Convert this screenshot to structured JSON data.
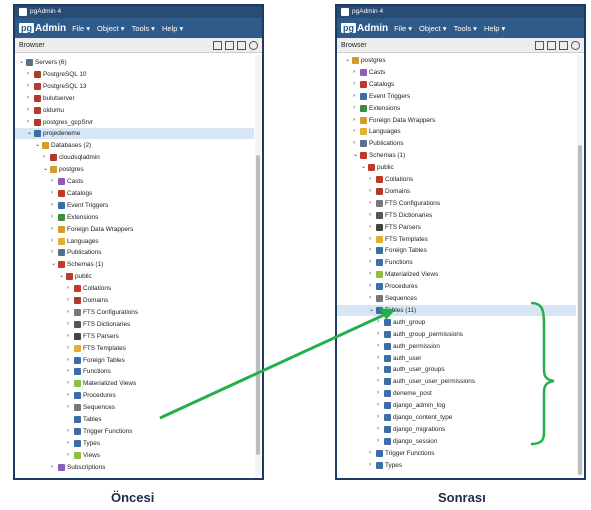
{
  "window_title": "pgAdmin 4",
  "logo": {
    "pg": "pg",
    "rest": "Admin"
  },
  "menus": [
    "File ▾",
    "Object ▾",
    "Tools ▾",
    "Help ▾"
  ],
  "browser_label": "Browser",
  "captions": {
    "left": "Öncesi",
    "right": "Sonrası"
  },
  "colors": {
    "header": "#2f5b8a",
    "arrow": "#22b04b",
    "selected": "#d6e6f5"
  },
  "left_tree": [
    {
      "label": "Servers (6)",
      "depth": 0,
      "toggle": "v",
      "icon": "servers-icon",
      "color": "#5a6f8c"
    },
    {
      "label": "PostgreSQL 10",
      "depth": 1,
      "toggle": ">",
      "icon": "server-icon",
      "color": "#b03a2e"
    },
    {
      "label": "PostgreSQL 13",
      "depth": 1,
      "toggle": ">",
      "icon": "server-icon",
      "color": "#b03a2e"
    },
    {
      "label": "bulutserver",
      "depth": 1,
      "toggle": ">",
      "icon": "server-icon",
      "color": "#b03a2e"
    },
    {
      "label": "oldumu",
      "depth": 1,
      "toggle": ">",
      "icon": "server-icon",
      "color": "#b03a2e"
    },
    {
      "label": "postgres_gcpSrvr",
      "depth": 1,
      "toggle": ">",
      "icon": "server-icon",
      "color": "#b03a2e"
    },
    {
      "label": "projedeneme",
      "depth": 1,
      "toggle": "v",
      "icon": "server-connected-icon",
      "color": "#3a6ea5",
      "selected": true
    },
    {
      "label": "Databases (2)",
      "depth": 2,
      "toggle": "v",
      "icon": "databases-icon",
      "color": "#d39b2a"
    },
    {
      "label": "cloudsqladmin",
      "depth": 3,
      "toggle": ">",
      "icon": "database-icon",
      "color": "#b03a2e"
    },
    {
      "label": "postgres",
      "depth": 3,
      "toggle": "v",
      "icon": "database-icon",
      "color": "#d39b2a"
    },
    {
      "label": "Casts",
      "depth": 4,
      "toggle": ">",
      "icon": "casts-icon",
      "color": "#8e5bb5"
    },
    {
      "label": "Catalogs",
      "depth": 4,
      "toggle": ">",
      "icon": "catalogs-icon",
      "color": "#c0392b"
    },
    {
      "label": "Event Triggers",
      "depth": 4,
      "toggle": ">",
      "icon": "event-triggers-icon",
      "color": "#3a6ea5"
    },
    {
      "label": "Extensions",
      "depth": 4,
      "toggle": ">",
      "icon": "extensions-icon",
      "color": "#3c8d3c"
    },
    {
      "label": "Foreign Data Wrappers",
      "depth": 4,
      "toggle": ">",
      "icon": "fdw-icon",
      "color": "#d39b2a"
    },
    {
      "label": "Languages",
      "depth": 4,
      "toggle": ">",
      "icon": "languages-icon",
      "color": "#e0b22c"
    },
    {
      "label": "Publications",
      "depth": 4,
      "toggle": ">",
      "icon": "publications-icon",
      "color": "#5a6f8c"
    },
    {
      "label": "Schemas (1)",
      "depth": 4,
      "toggle": "v",
      "icon": "schemas-icon",
      "color": "#c0392b"
    },
    {
      "label": "public",
      "depth": 5,
      "toggle": "v",
      "icon": "schema-icon",
      "color": "#c0392b"
    },
    {
      "label": "Collations",
      "depth": 6,
      "toggle": ">",
      "icon": "collations-icon",
      "color": "#c0392b"
    },
    {
      "label": "Domains",
      "depth": 6,
      "toggle": ">",
      "icon": "domains-icon",
      "color": "#b03a2e"
    },
    {
      "label": "FTS Configurations",
      "depth": 6,
      "toggle": ">",
      "icon": "fts-config-icon",
      "color": "#777777"
    },
    {
      "label": "FTS Dictionaries",
      "depth": 6,
      "toggle": ">",
      "icon": "fts-dict-icon",
      "color": "#555555"
    },
    {
      "label": "FTS Parsers",
      "depth": 6,
      "toggle": ">",
      "icon": "fts-parsers-icon",
      "color": "#444444"
    },
    {
      "label": "FTS Templates",
      "depth": 6,
      "toggle": ">",
      "icon": "fts-templates-icon",
      "color": "#e0b22c"
    },
    {
      "label": "Foreign Tables",
      "depth": 6,
      "toggle": ">",
      "icon": "foreign-tables-icon",
      "color": "#3a6ea5"
    },
    {
      "label": "Functions",
      "depth": 6,
      "toggle": ">",
      "icon": "functions-icon",
      "color": "#3a6ea5"
    },
    {
      "label": "Materialized Views",
      "depth": 6,
      "toggle": ">",
      "icon": "mviews-icon",
      "color": "#8cbf3f"
    },
    {
      "label": "Procedures",
      "depth": 6,
      "toggle": ">",
      "icon": "procedures-icon",
      "color": "#3a6ea5"
    },
    {
      "label": "Sequences",
      "depth": 6,
      "toggle": ">",
      "icon": "sequences-icon",
      "color": "#777777"
    },
    {
      "label": "Tables",
      "depth": 6,
      "toggle": "",
      "icon": "tables-icon",
      "color": "#3a6ea5"
    },
    {
      "label": "Trigger Functions",
      "depth": 6,
      "toggle": ">",
      "icon": "trigger-functions-icon",
      "color": "#3a6ea5"
    },
    {
      "label": "Types",
      "depth": 6,
      "toggle": ">",
      "icon": "types-icon",
      "color": "#3a6ea5"
    },
    {
      "label": "Views",
      "depth": 6,
      "toggle": ">",
      "icon": "views-icon",
      "color": "#8cbf3f"
    },
    {
      "label": "Subscriptions",
      "depth": 4,
      "toggle": ">",
      "icon": "subscriptions-icon",
      "color": "#8e5bb5"
    }
  ],
  "right_tree": [
    {
      "label": "postgres",
      "depth": 3,
      "toggle": "v",
      "icon": "database-icon",
      "color": "#d39b2a"
    },
    {
      "label": "Casts",
      "depth": 4,
      "toggle": ">",
      "icon": "casts-icon",
      "color": "#8e5bb5"
    },
    {
      "label": "Catalogs",
      "depth": 4,
      "toggle": ">",
      "icon": "catalogs-icon",
      "color": "#c0392b"
    },
    {
      "label": "Event Triggers",
      "depth": 4,
      "toggle": ">",
      "icon": "event-triggers-icon",
      "color": "#3a6ea5"
    },
    {
      "label": "Extensions",
      "depth": 4,
      "toggle": ">",
      "icon": "extensions-icon",
      "color": "#3c8d3c"
    },
    {
      "label": "Foreign Data Wrappers",
      "depth": 4,
      "toggle": ">",
      "icon": "fdw-icon",
      "color": "#d39b2a"
    },
    {
      "label": "Languages",
      "depth": 4,
      "toggle": ">",
      "icon": "languages-icon",
      "color": "#e0b22c"
    },
    {
      "label": "Publications",
      "depth": 4,
      "toggle": ">",
      "icon": "publications-icon",
      "color": "#5a6f8c"
    },
    {
      "label": "Schemas (1)",
      "depth": 4,
      "toggle": "v",
      "icon": "schemas-icon",
      "color": "#c0392b"
    },
    {
      "label": "public",
      "depth": 5,
      "toggle": "v",
      "icon": "schema-icon",
      "color": "#c0392b"
    },
    {
      "label": "Collations",
      "depth": 6,
      "toggle": ">",
      "icon": "collations-icon",
      "color": "#c0392b"
    },
    {
      "label": "Domains",
      "depth": 6,
      "toggle": ">",
      "icon": "domains-icon",
      "color": "#b03a2e"
    },
    {
      "label": "FTS Configurations",
      "depth": 6,
      "toggle": ">",
      "icon": "fts-config-icon",
      "color": "#777777"
    },
    {
      "label": "FTS Dictionaries",
      "depth": 6,
      "toggle": ">",
      "icon": "fts-dict-icon",
      "color": "#555555"
    },
    {
      "label": "FTS Parsers",
      "depth": 6,
      "toggle": ">",
      "icon": "fts-parsers-icon",
      "color": "#444444"
    },
    {
      "label": "FTS Templates",
      "depth": 6,
      "toggle": ">",
      "icon": "fts-templates-icon",
      "color": "#e0b22c"
    },
    {
      "label": "Foreign Tables",
      "depth": 6,
      "toggle": ">",
      "icon": "foreign-tables-icon",
      "color": "#3a6ea5"
    },
    {
      "label": "Functions",
      "depth": 6,
      "toggle": ">",
      "icon": "functions-icon",
      "color": "#3a6ea5"
    },
    {
      "label": "Materialized Views",
      "depth": 6,
      "toggle": ">",
      "icon": "mviews-icon",
      "color": "#8cbf3f"
    },
    {
      "label": "Procedures",
      "depth": 6,
      "toggle": ">",
      "icon": "procedures-icon",
      "color": "#3a6ea5"
    },
    {
      "label": "Sequences",
      "depth": 6,
      "toggle": ">",
      "icon": "sequences-icon",
      "color": "#777777"
    },
    {
      "label": "Tables (11)",
      "depth": 6,
      "toggle": "v",
      "icon": "tables-icon",
      "color": "#3a6ea5",
      "selected": true
    },
    {
      "label": "auth_group",
      "depth": 7,
      "toggle": ">",
      "icon": "table-icon",
      "color": "#3a6ea5"
    },
    {
      "label": "auth_group_permissions",
      "depth": 7,
      "toggle": ">",
      "icon": "table-icon",
      "color": "#3a6ea5"
    },
    {
      "label": "auth_permission",
      "depth": 7,
      "toggle": ">",
      "icon": "table-icon",
      "color": "#3a6ea5"
    },
    {
      "label": "auth_user",
      "depth": 7,
      "toggle": ">",
      "icon": "table-icon",
      "color": "#3a6ea5"
    },
    {
      "label": "auth_user_groups",
      "depth": 7,
      "toggle": ">",
      "icon": "table-icon",
      "color": "#3a6ea5"
    },
    {
      "label": "auth_user_user_permissions",
      "depth": 7,
      "toggle": ">",
      "icon": "table-icon",
      "color": "#3a6ea5"
    },
    {
      "label": "deneme_post",
      "depth": 7,
      "toggle": ">",
      "icon": "table-icon",
      "color": "#3a6ea5"
    },
    {
      "label": "django_admin_log",
      "depth": 7,
      "toggle": ">",
      "icon": "table-icon",
      "color": "#3a6ea5"
    },
    {
      "label": "django_content_type",
      "depth": 7,
      "toggle": ">",
      "icon": "table-icon",
      "color": "#3a6ea5"
    },
    {
      "label": "django_migrations",
      "depth": 7,
      "toggle": ">",
      "icon": "table-icon",
      "color": "#3a6ea5"
    },
    {
      "label": "django_session",
      "depth": 7,
      "toggle": ">",
      "icon": "table-icon",
      "color": "#3a6ea5"
    },
    {
      "label": "Trigger Functions",
      "depth": 6,
      "toggle": ">",
      "icon": "trigger-functions-icon",
      "color": "#3a6ea5"
    },
    {
      "label": "Types",
      "depth": 6,
      "toggle": ">",
      "icon": "types-icon",
      "color": "#3a6ea5"
    }
  ]
}
